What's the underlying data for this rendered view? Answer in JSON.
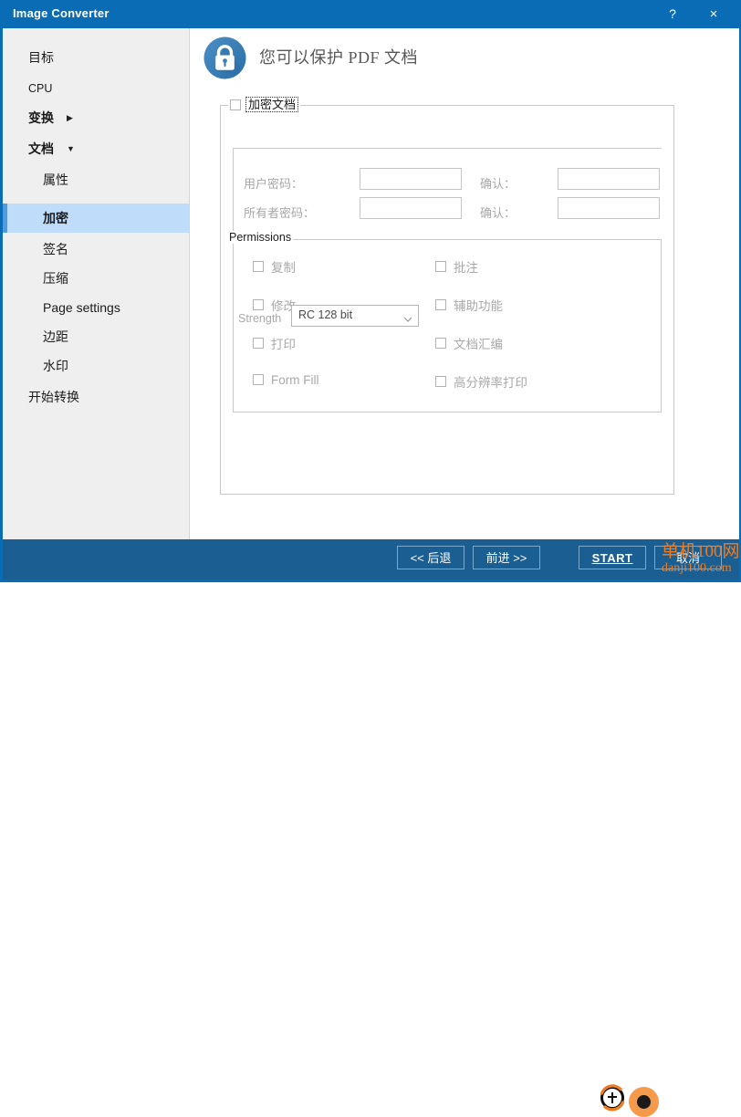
{
  "window": {
    "title": "Image Converter",
    "help_label": "?",
    "close_label": "×"
  },
  "sidebar": {
    "items": [
      {
        "label": "目标",
        "level": 0,
        "bold": false,
        "caret": ""
      },
      {
        "label": "CPU",
        "level": 0,
        "bold": false,
        "caret": ""
      },
      {
        "label": "变换",
        "level": 0,
        "bold": true,
        "caret": "▶"
      },
      {
        "label": "文档",
        "level": 0,
        "bold": true,
        "caret": "▼"
      },
      {
        "label": "属性",
        "level": 1,
        "bold": false,
        "caret": ""
      },
      {
        "label": "加密",
        "level": 1,
        "bold": true,
        "caret": "",
        "selected": true
      },
      {
        "label": "签名",
        "level": 1,
        "bold": false,
        "caret": ""
      },
      {
        "label": "压缩",
        "level": 1,
        "bold": false,
        "caret": ""
      },
      {
        "label": "Page settings",
        "level": 1,
        "bold": false,
        "caret": ""
      },
      {
        "label": "边距",
        "level": 1,
        "bold": false,
        "caret": ""
      },
      {
        "label": "水印",
        "level": 1,
        "bold": false,
        "caret": ""
      },
      {
        "label": "开始转换",
        "level": 0,
        "bold": false,
        "caret": ""
      }
    ]
  },
  "header": {
    "title": "您可以保护 PDF 文档",
    "icon": "lock-icon"
  },
  "encryption": {
    "group_label": "加密文档",
    "group_checked": false,
    "user_password_label": "用户密码：",
    "user_password_value": "",
    "user_confirm_label": "确认：",
    "user_confirm_value": "",
    "owner_password_label": "所有者密码：",
    "owner_password_value": "",
    "owner_confirm_label": "确认：",
    "owner_confirm_value": ""
  },
  "permissions": {
    "group_label": "Permissions",
    "left": [
      {
        "label": "复制",
        "checked": false
      },
      {
        "label": "修改",
        "checked": false
      },
      {
        "label": "打印",
        "checked": false
      },
      {
        "label": "Form Fill",
        "checked": false
      }
    ],
    "right": [
      {
        "label": "批注",
        "checked": false
      },
      {
        "label": "辅助功能",
        "checked": false
      },
      {
        "label": "文档汇编",
        "checked": false
      },
      {
        "label": "高分辨率打印",
        "checked": false
      }
    ]
  },
  "strength": {
    "label": "Strength",
    "value": "RC 128 bit",
    "options": [
      "RC 128 bit"
    ]
  },
  "footer": {
    "back_label": "<< 后退",
    "next_label": "前进 >>",
    "start_label": "START",
    "cancel_label": "取消"
  },
  "watermark": {
    "line1": "单机100网",
    "line2": "danji100.com"
  },
  "colors": {
    "titlebar": "#0a6cb5",
    "footer": "#1b5e91",
    "selection": "#bfdcfa",
    "selection_bar": "#4f9ae0",
    "watermark": "#f07c20"
  }
}
